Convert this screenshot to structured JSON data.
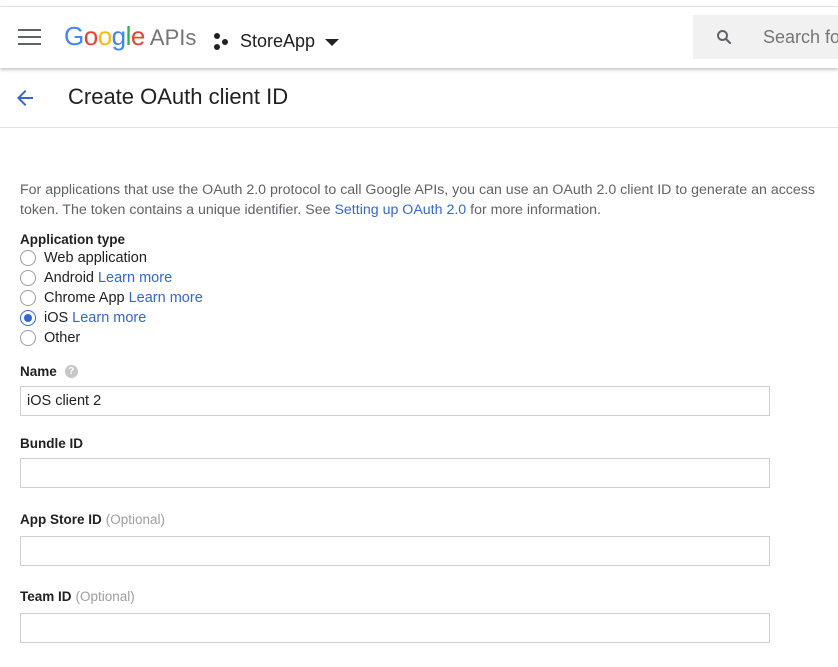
{
  "header": {
    "logo_google": "Google",
    "logo_apis": "APIs",
    "project_name": "StoreApp",
    "search_placeholder": "Search fo"
  },
  "page": {
    "title": "Create OAuth client ID"
  },
  "intro": {
    "text_before": "For applications that use the OAuth 2.0 protocol to call Google APIs, you can use an OAuth 2.0 client ID to generate an access token. The token contains a unique identifier. See ",
    "link": "Setting up OAuth 2.0",
    "text_after": " for more information."
  },
  "application_type": {
    "label": "Application type",
    "options": [
      {
        "label": "Web application",
        "link": "",
        "checked": false
      },
      {
        "label": "Android",
        "link": "Learn more",
        "checked": false
      },
      {
        "label": "Chrome App",
        "link": "Learn more",
        "checked": false
      },
      {
        "label": "iOS",
        "link": "Learn more",
        "checked": true
      },
      {
        "label": "Other",
        "link": "",
        "checked": false
      }
    ]
  },
  "fields": {
    "name": {
      "label": "Name",
      "value": "iOS client 2"
    },
    "bundle_id": {
      "label": "Bundle ID",
      "value": ""
    },
    "app_store_id": {
      "label": "App Store ID",
      "optional": "(Optional)",
      "value": ""
    },
    "team_id": {
      "label": "Team ID",
      "optional": "(Optional)",
      "value": ""
    }
  },
  "colors": {
    "accent": "#3367d6",
    "google_blue": "#4285f4",
    "google_red": "#ea4335",
    "google_yellow": "#fbbc05",
    "google_green": "#34a853"
  }
}
